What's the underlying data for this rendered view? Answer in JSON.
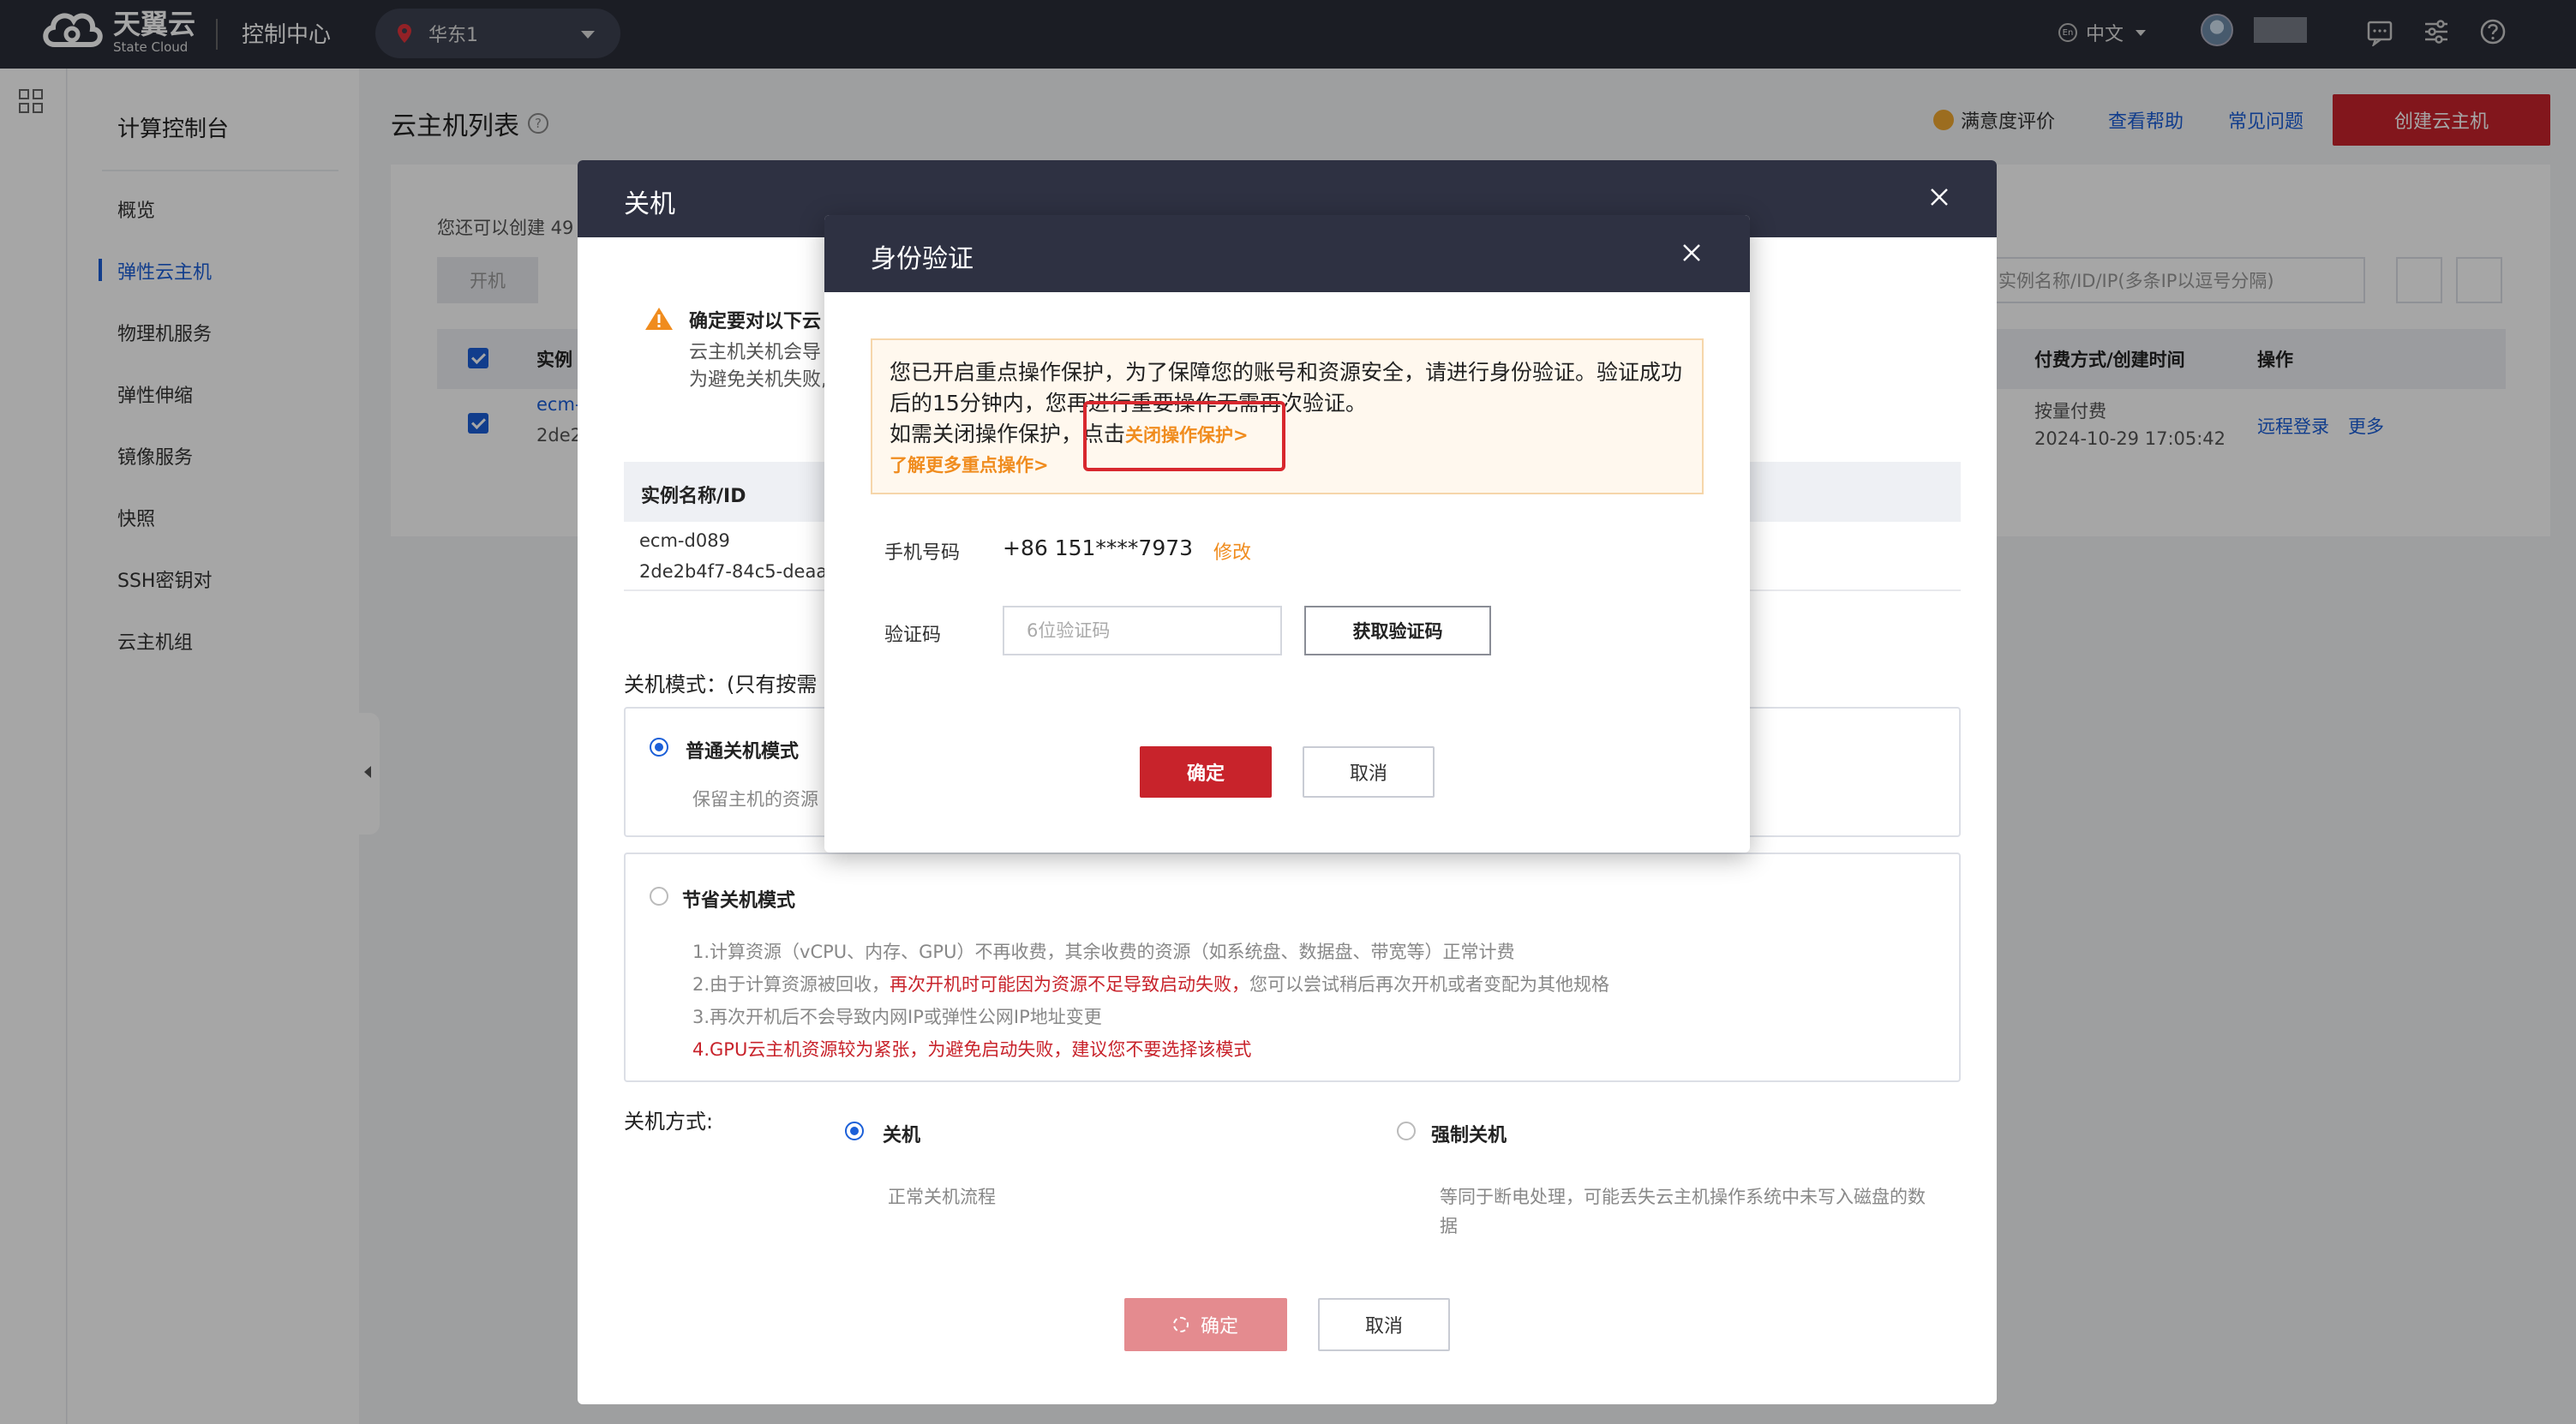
{
  "header": {
    "logo_cn": "天翼云",
    "logo_en": "State Cloud",
    "console_title": "控制中心",
    "region": "华东1",
    "language": "中文",
    "lang_badge": "En"
  },
  "sidebar": {
    "title": "计算控制台",
    "items": [
      {
        "label": "概览"
      },
      {
        "label": "弹性云主机",
        "active": true
      },
      {
        "label": "物理机服务"
      },
      {
        "label": "弹性伸缩"
      },
      {
        "label": "镜像服务"
      },
      {
        "label": "快照"
      },
      {
        "label": "SSH密钥对"
      },
      {
        "label": "云主机组"
      }
    ]
  },
  "page": {
    "title": "云主机列表",
    "satisfaction": "满意度评价",
    "help": "查看帮助",
    "faq": "常见问题",
    "create_button": "创建云主机"
  },
  "list": {
    "quota_text": "您还可以创建 49",
    "power_on": "开机",
    "search_placeholder": "实例名称/ID/IP(多条IP以逗号分隔)",
    "col_instance": "实例",
    "col_billing": "付费方式/创建时间",
    "col_ops": "操作",
    "row": {
      "name": "ecm-",
      "id": "2de2",
      "billing": "按量付费",
      "created": "2024-10-29 17:05:42",
      "remote_login": "远程登录",
      "more": "更多"
    }
  },
  "shutdown_modal": {
    "title": "关机",
    "warn_title": "确定要对以下云",
    "warn_line1": "云主机关机会导",
    "warn_line2": "为避免关机失败,",
    "table_header": "实例名称/ID",
    "instance_name": "ecm-d089",
    "instance_id": "2de2b4f7-84c5-deaa-",
    "mode_label": "关机模式：(只有按需",
    "normal_mode": "普通关机模式",
    "normal_desc": "保留主机的资源",
    "saving_mode": "节省关机模式",
    "saving_bullets": {
      "b1": "1.计算资源（vCPU、内存、GPU）不再收费，其余收费的资源（如系统盘、数据盘、带宽等）正常计费",
      "b2_pre": "2.由于计算资源被回收，",
      "b2_red": "再次开机时可能因为资源不足导致启动失败，",
      "b2_post": "您可以尝试稍后再次开机或者变配为其他规格",
      "b3": "3.再次开机后不会导致内网IP或弹性公网IP地址变更",
      "b4": "4.GPU云主机资源较为紧张，为避免启动失败，建议您不要选择该模式"
    },
    "method_label": "关机方式:",
    "method_normal": "关机",
    "method_normal_desc": "正常关机流程",
    "method_force": "强制关机",
    "method_force_desc1": "等同于断电处理，可能丢失云主机操作系统中未写入磁盘的数",
    "method_force_desc2": "据",
    "ok": "确定",
    "cancel": "取消"
  },
  "identity_modal": {
    "title": "身份验证",
    "notice_line1": "您已开启重点操作保护，为了保障您的账号和资源安全，请进行身份验证。验证成功",
    "notice_line2": "后的15分钟内，您再进行重要操作无需再次验证。",
    "notice_line3_pre": "如需关闭操作保护，点击",
    "notice_link": "关闭操作保护>",
    "notice_link2": "了解更多重点操作>",
    "phone_label": "手机号码",
    "phone_value": "+86 151****7973",
    "modify": "修改",
    "code_label": "验证码",
    "code_placeholder": "6位验证码",
    "get_code": "获取验证码",
    "ok": "确定",
    "cancel": "取消"
  },
  "colors": {
    "brand_red": "#c8232b",
    "link_blue": "#1b5fd8",
    "link_orange": "#f08c1e",
    "header_dark": "#2a2d38"
  }
}
